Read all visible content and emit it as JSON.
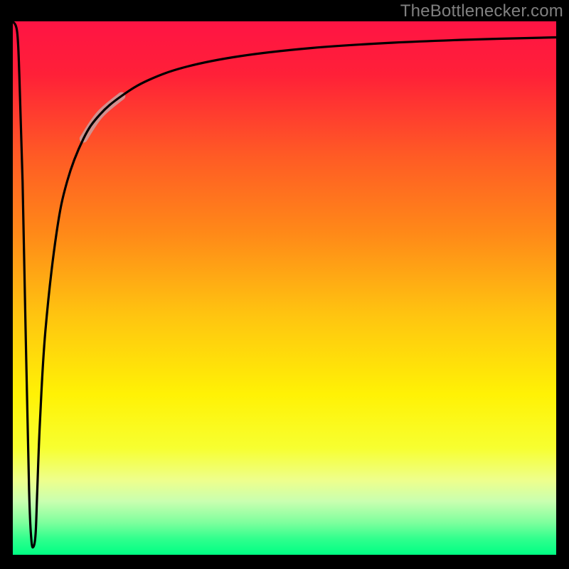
{
  "attribution": "TheBottlenecker.com",
  "chart_data": {
    "type": "line",
    "title": "",
    "xlabel": "",
    "ylabel": "",
    "xlim": [
      0,
      100
    ],
    "ylim": [
      0,
      100
    ],
    "legend": false,
    "gradient_stops": [
      {
        "offset": 0.0,
        "color": "#ff1444"
      },
      {
        "offset": 0.1,
        "color": "#ff2038"
      },
      {
        "offset": 0.25,
        "color": "#ff5a25"
      },
      {
        "offset": 0.4,
        "color": "#ff8a18"
      },
      {
        "offset": 0.55,
        "color": "#ffc410"
      },
      {
        "offset": 0.7,
        "color": "#fff205"
      },
      {
        "offset": 0.8,
        "color": "#f7ff30"
      },
      {
        "offset": 0.86,
        "color": "#eeff8c"
      },
      {
        "offset": 0.9,
        "color": "#c9ffb0"
      },
      {
        "offset": 0.94,
        "color": "#7dff9d"
      },
      {
        "offset": 0.97,
        "color": "#30ff8d"
      },
      {
        "offset": 1.0,
        "color": "#00ff84"
      }
    ],
    "series": [
      {
        "name": "curve",
        "x": [
          0.0,
          0.8,
          1.2,
          1.8,
          2.4,
          3.0,
          3.4,
          3.8,
          4.2,
          4.5,
          5.0,
          6.0,
          8.0,
          10.0,
          13.0,
          16.0,
          20.0,
          25.0,
          32.0,
          42.0,
          55.0,
          70.0,
          85.0,
          100.0
        ],
        "y": [
          100.0,
          98.0,
          90.0,
          70.0,
          40.0,
          12.0,
          3.0,
          1.5,
          4.0,
          12.0,
          25.0,
          42.0,
          60.0,
          70.0,
          78.0,
          82.5,
          86.0,
          89.0,
          91.5,
          93.5,
          95.0,
          96.0,
          96.6,
          97.0
        ]
      },
      {
        "name": "highlight_segment",
        "x": [
          13.0,
          16.0,
          20.0
        ],
        "y": [
          78.0,
          82.5,
          86.0
        ]
      }
    ],
    "highlight_style": {
      "stroke": "#c8a0a0",
      "width": 11,
      "opacity": 0.85
    }
  }
}
